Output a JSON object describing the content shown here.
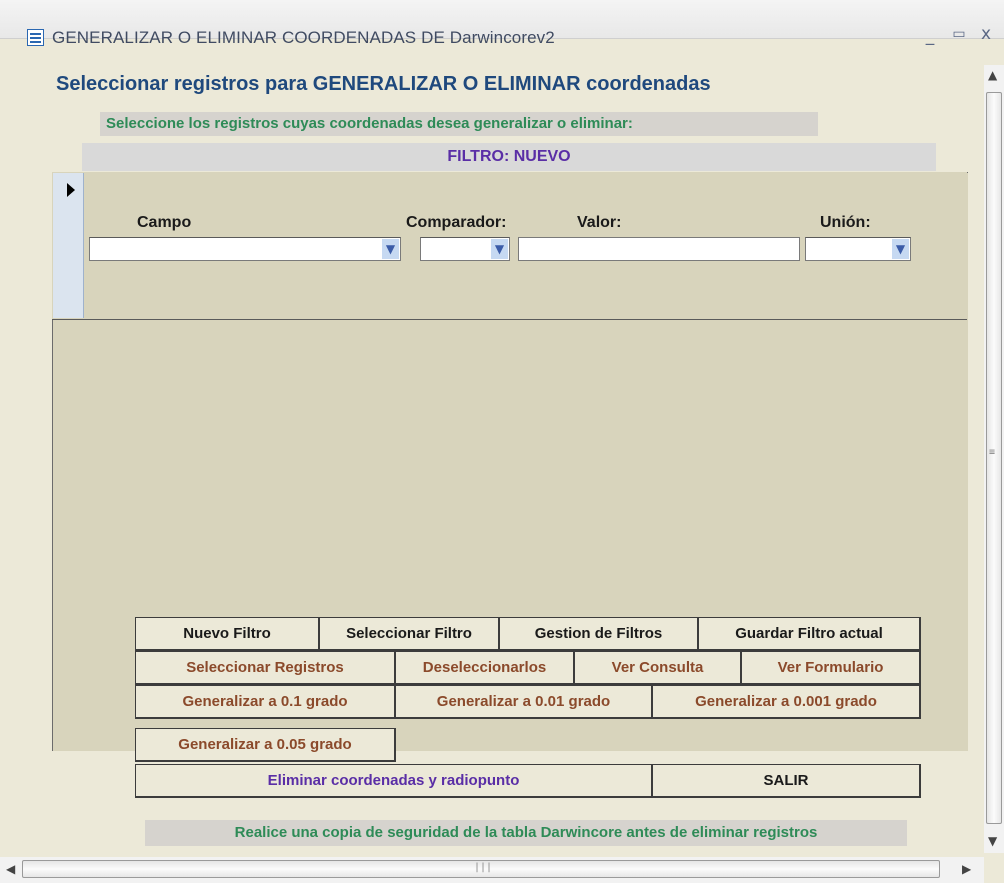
{
  "window": {
    "title": "GENERALIZAR O ELIMINAR COORDENADAS DE Darwincorev2",
    "minimize": "_",
    "maximize": "▭",
    "close": "x"
  },
  "heading": "Seleccionar registros para GENERALIZAR O ELIMINAR coordenadas",
  "instruction": "Seleccione los registros cuyas coordenadas desea generalizar o eliminar:",
  "filter_title": "FILTRO:  NUEVO",
  "filter_row": {
    "campo_label": "Campo",
    "comparador_label": "Comparador:",
    "valor_label": "Valor:",
    "union_label": "Unión:",
    "campo_value": "",
    "comparador_value": "",
    "valor_value": "",
    "union_value": ""
  },
  "buttons": {
    "nuevo_filtro": "Nuevo Filtro",
    "seleccionar_filtro": "Seleccionar Filtro",
    "gestion_filtros": "Gestion de Filtros",
    "guardar_filtro": "Guardar Filtro actual",
    "seleccionar_registros": "Seleccionar Registros",
    "deseleccionarlos": "Deseleccionarlos",
    "ver_consulta": "Ver Consulta",
    "ver_formulario": "Ver Formulario",
    "gen_01": "Generalizar a 0.1 grado",
    "gen_001": "Generalizar a 0.01 grado",
    "gen_0001": "Generalizar a 0.001 grado",
    "gen_005": "Generalizar a 0.05 grado",
    "eliminar": "Eliminar coordenadas y radiopunto",
    "salir": "SALIR"
  },
  "warning": "Realice una copia de seguridad de la tabla Darwincore antes de eliminar registros",
  "colors": {
    "heading": "#1f497d",
    "green_text": "#2e8b57",
    "purple_text": "#5a2ea6",
    "brown_text": "#8b4a2b"
  }
}
